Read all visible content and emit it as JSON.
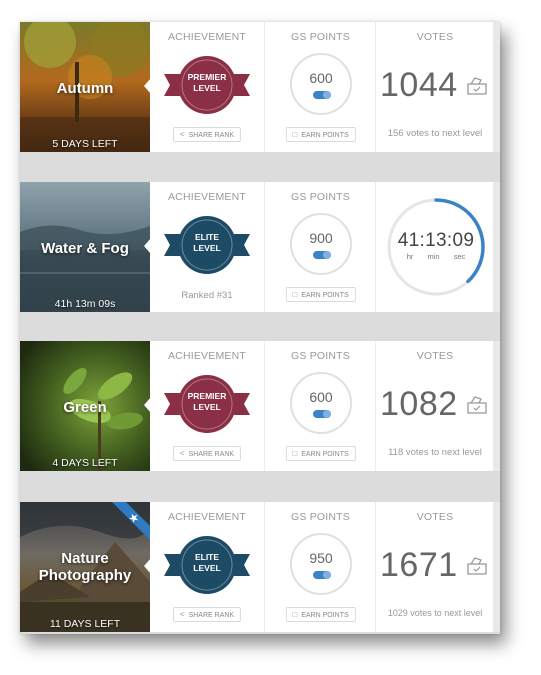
{
  "colors": {
    "premier": "#8b2f46",
    "elite": "#1d4b66",
    "accent": "#3b83c6"
  },
  "labels": {
    "achievement": "ACHIEVEMENT",
    "gs_points": "GS POINTS",
    "votes": "VOTES",
    "share_rank": "SHARE RANK",
    "earn_points": "EARN POINTS"
  },
  "challenges": [
    {
      "name": "Autumn",
      "time_left": "5 DAYS LEFT",
      "level_top": "PREMIER",
      "level_bottom": "LEVEL",
      "gs_points": "600",
      "votes": "1044",
      "next_level": "156 votes to next level"
    },
    {
      "name": "Water & Fog",
      "time_left": "41h 13m 09s",
      "level_top": "ELITE",
      "level_bottom": "LEVEL",
      "ranked": "Ranked #31",
      "gs_points": "900",
      "timer": {
        "hours": "41",
        "minutes": "13",
        "seconds": "09",
        "unit_hr": "hr",
        "unit_min": "min",
        "unit_sec": "sec",
        "progress": 0.38
      }
    },
    {
      "name": "Green",
      "time_left": "4 DAYS LEFT",
      "level_top": "PREMIER",
      "level_bottom": "LEVEL",
      "gs_points": "600",
      "votes": "1082",
      "next_level": "118 votes to next level"
    },
    {
      "name_line1": "Nature",
      "name_line2": "Photography",
      "time_left": "11 DAYS LEFT",
      "level_top": "ELITE",
      "level_bottom": "LEVEL",
      "gs_points": "950",
      "votes": "1671",
      "next_level": "1029 votes to next level",
      "ribbon_icon": "star-icon"
    }
  ]
}
